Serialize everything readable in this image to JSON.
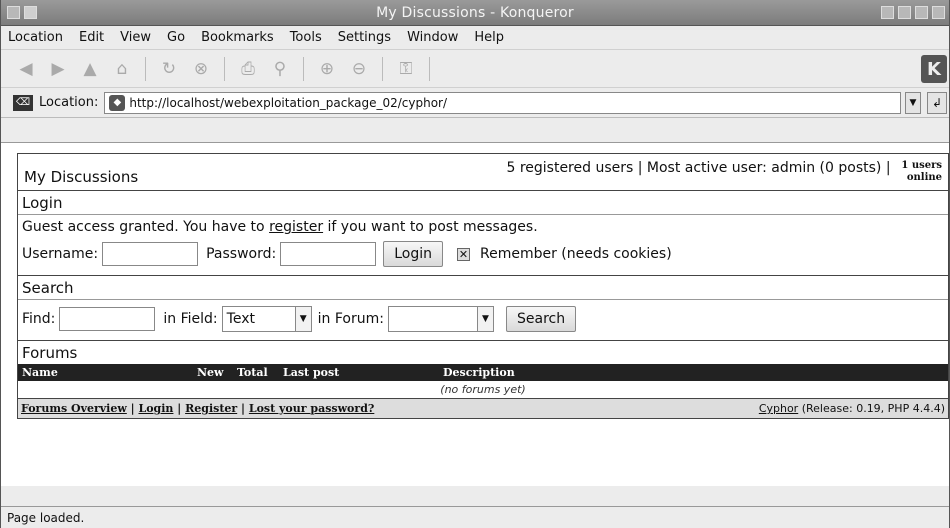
{
  "window": {
    "title": "My Discussions - Konqueror"
  },
  "menu": [
    "Location",
    "Edit",
    "View",
    "Go",
    "Bookmarks",
    "Tools",
    "Settings",
    "Window",
    "Help"
  ],
  "location": {
    "label": "Location:",
    "url": "http://localhost/webexploitation_package_02/cyphor/"
  },
  "page": {
    "title": "My Discussions",
    "stats": "5 registered users | Most active user: admin (0 posts) |",
    "online": "1 users online",
    "login": {
      "heading": "Login",
      "guest_pre": "Guest access granted. You have to ",
      "guest_link": "register",
      "guest_post": " if you want to post messages.",
      "username_label": "Username:",
      "password_label": "Password:",
      "login_button": "Login",
      "remember_label": "Remember (needs cookies)"
    },
    "search": {
      "heading": "Search",
      "find_label": "Find:",
      "field_label": "in Field:",
      "field_value": "Text",
      "forum_label": "in Forum:",
      "search_button": "Search"
    },
    "forums": {
      "heading": "Forums",
      "columns": [
        "Name",
        "New",
        "Total",
        "Last post",
        "Description"
      ],
      "empty": "(no forums yet)"
    },
    "footer": {
      "overview": "Forums Overview",
      "login": "Login",
      "register": "Register",
      "lost": "Lost your password?",
      "brand": "Cyphor",
      "release": "(Release: 0.19, PHP 4.4.4)"
    }
  },
  "status": "Page loaded."
}
